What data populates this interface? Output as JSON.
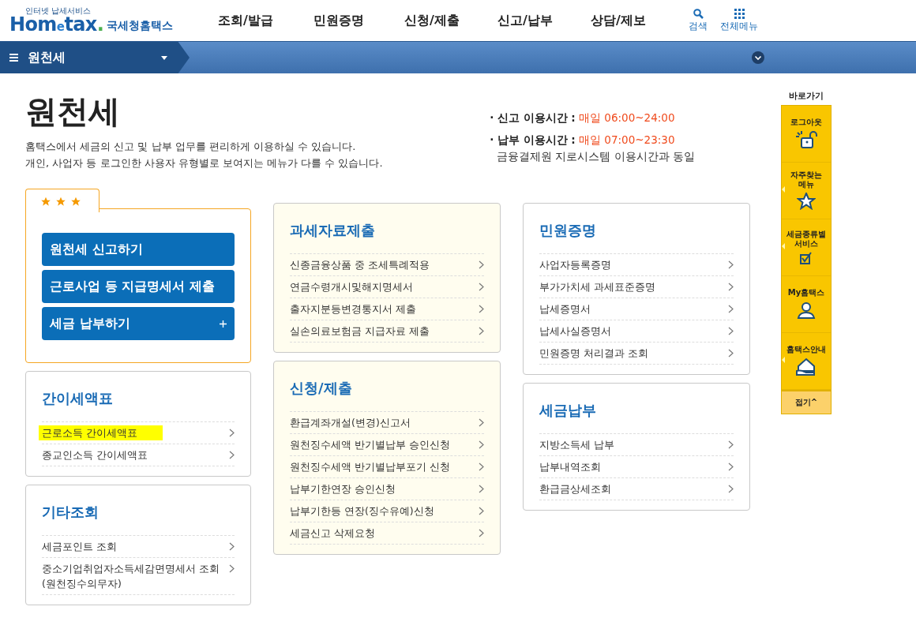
{
  "header": {
    "logo": {
      "tagline": "인터넷 납세서비스",
      "wordmark_start": "Hom",
      "wordmark_e": "e",
      "wordmark_end": "tax",
      "wordmark_dot": ".",
      "name": "국세청홈택스"
    },
    "menu": [
      "조회/발급",
      "민원증명",
      "신청/제출",
      "신고/납부",
      "상담/제보"
    ],
    "search_label": "검색",
    "all_menu_label": "전체메뉴"
  },
  "location_bar": {
    "current": "원천세"
  },
  "page": {
    "title": "원천세",
    "description": [
      "홈택스에서 세금의 신고 및 납부 업무를 편리하게 이용하실 수 있습니다.",
      "개인, 사업자 등 로그인한 사용자 유형별로 보여지는 메뉴가 다를 수 있습니다."
    ],
    "hours": [
      {
        "bullet": "·",
        "label": "신고 이용시간 :",
        "time": "매일 06:00~24:00"
      },
      {
        "bullet": "·",
        "label": "납부 이용시간 :",
        "time": "매일 07:00~23:30",
        "note": "금융결제원 지로시스템 이용시간과 동일"
      }
    ]
  },
  "featured": {
    "stars": 3,
    "buttons": [
      {
        "label": "원천세 신고하기",
        "expandable": false
      },
      {
        "label": "근로사업 등 지급명세서 제출",
        "expandable": false
      },
      {
        "label": "세금 납부하기",
        "expandable": true
      }
    ]
  },
  "columns": [
    [
      {
        "title": "간이세액표",
        "tinted": false,
        "items": [
          {
            "label": "근로소득 간이세액표",
            "highlighted": true
          },
          {
            "label": "종교인소득 간이세액표",
            "highlighted": false
          }
        ]
      },
      {
        "title": "기타조회",
        "tinted": false,
        "items": [
          {
            "label": "세금포인트 조회",
            "highlighted": false
          },
          {
            "label": "중소기업취업자소득세감면명세서 조회\n(원천징수의무자)",
            "highlighted": false
          }
        ]
      }
    ],
    [
      {
        "title": "과세자료제출",
        "tinted": true,
        "items": [
          {
            "label": "신종금융상품 중 조세특례적용",
            "highlighted": false
          },
          {
            "label": "연금수령개시및해지명세서",
            "highlighted": false
          },
          {
            "label": "출자지분등변경통지서 제출",
            "highlighted": false
          },
          {
            "label": "실손의료보험금 지급자료 제출",
            "highlighted": false
          }
        ]
      },
      {
        "title": "신청/제출",
        "tinted": true,
        "items": [
          {
            "label": "환급계좌개설(변경)신고서",
            "highlighted": false
          },
          {
            "label": "원천징수세액 반기별납부 승인신청",
            "highlighted": false
          },
          {
            "label": "원천징수세액 반기별납부포기 신청",
            "highlighted": false
          },
          {
            "label": "납부기한연장 승인신청",
            "highlighted": false
          },
          {
            "label": "납부기한등 연장(징수유예)신청",
            "highlighted": false
          },
          {
            "label": "세금신고 삭제요청",
            "highlighted": false
          }
        ]
      }
    ],
    [
      {
        "title": "민원증명",
        "tinted": false,
        "items": [
          {
            "label": "사업자등록증명",
            "highlighted": false
          },
          {
            "label": "부가가치세 과세표준증명",
            "highlighted": false
          },
          {
            "label": "납세증명서",
            "highlighted": false
          },
          {
            "label": "납세사실증명서",
            "highlighted": false
          },
          {
            "label": "민원증명 처리결과 조회",
            "highlighted": false
          }
        ]
      },
      {
        "title": "세금납부",
        "tinted": false,
        "items": [
          {
            "label": "지방소득세 납부",
            "highlighted": false
          },
          {
            "label": "납부내역조회",
            "highlighted": false
          },
          {
            "label": "환급금상세조회",
            "highlighted": false
          }
        ]
      }
    ]
  ],
  "quick_menu": {
    "title": "바로가기",
    "items": [
      {
        "label": "로그아웃",
        "kind": "lock",
        "submenu": false
      },
      {
        "label": "자주찾는\n메뉴",
        "kind": "star",
        "submenu": true
      },
      {
        "label": "세금종류별\n서비스",
        "kind": "check",
        "submenu": true
      },
      {
        "label": "My홈택스",
        "kind": "person",
        "submenu": false
      },
      {
        "label": "홈택스안내",
        "kind": "house",
        "submenu": true
      }
    ],
    "fold": "접기^"
  }
}
